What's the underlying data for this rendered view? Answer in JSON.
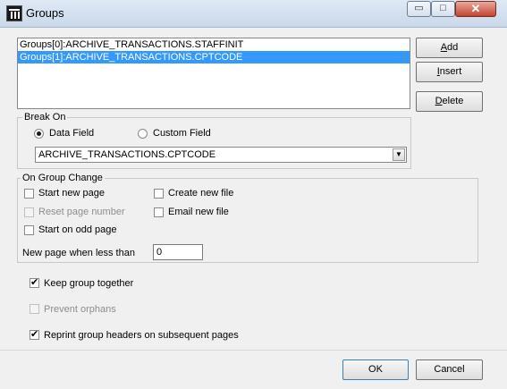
{
  "window": {
    "title": "Groups",
    "minimize_symbol": "▭",
    "maximize_symbol": "□",
    "close_symbol": "✕"
  },
  "groups_list": {
    "items": [
      {
        "label": "Groups[0]:ARCHIVE_TRANSACTIONS.STAFFINIT",
        "selected": false
      },
      {
        "label": "Groups[1]:ARCHIVE_TRANSACTIONS.CPTCODE",
        "selected": true
      }
    ]
  },
  "side_buttons": {
    "add": {
      "label": "Add",
      "underline_char": "A",
      "rest": "dd"
    },
    "insert": {
      "label": "Insert",
      "underline_char": "I",
      "rest": "nsert"
    },
    "delete": {
      "label": "Delete",
      "underline_char": "D",
      "rest": "elete"
    }
  },
  "break_on": {
    "label": "Break On",
    "data_field_label": "Data Field",
    "custom_field_label": "Custom Field",
    "selected": "data_field",
    "field_value": "ARCHIVE_TRANSACTIONS.CPTCODE"
  },
  "on_group_change": {
    "label": "On Group Change",
    "start_new_page": {
      "label": "Start new page",
      "checked": false
    },
    "reset_page_number": {
      "label": "Reset page number",
      "checked": false,
      "disabled": true
    },
    "start_on_odd_page": {
      "label": "Start on odd page",
      "checked": false
    },
    "create_new_file": {
      "label": "Create new file",
      "checked": false
    },
    "email_new_file": {
      "label": "Email new file",
      "checked": false
    },
    "new_page_when_less_than": {
      "label": "New page when less than",
      "value": "0"
    }
  },
  "options": {
    "keep_group_together": {
      "label": "Keep group together",
      "checked": true
    },
    "prevent_orphans": {
      "label": "Prevent orphans",
      "checked": false,
      "disabled": true
    },
    "reprint_headers": {
      "label": "Reprint group headers on subsequent pages",
      "checked": true
    }
  },
  "footer": {
    "ok_label": "OK",
    "cancel_label": "Cancel"
  },
  "check_mark": "✔"
}
